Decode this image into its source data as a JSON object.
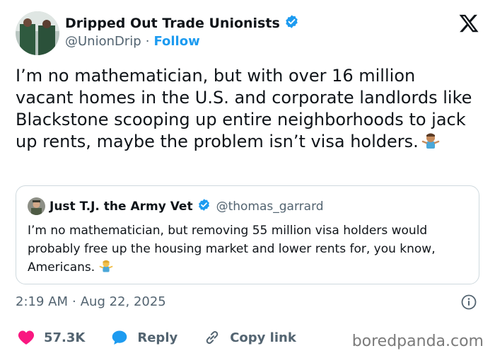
{
  "author": {
    "display_name": "Dripped Out Trade Unionists",
    "handle": "@UnionDrip",
    "separator": "·",
    "follow_label": "Follow",
    "verified": true
  },
  "tweet": {
    "text": "I’m no mathematician, but with over 16 million vacant homes in the U.S. and corporate landlords like Blackstone scooping up entire neighborhoods to jack up rents, maybe the problem isn’t visa holders.",
    "emoji": "shrug"
  },
  "quoted_tweet": {
    "display_name": "Just T.J. the Army Vet",
    "handle": "@thomas_garrard",
    "verified": true,
    "text": "I’m no mathematician, but removing 55 million visa holders would probably free up the housing market and lower rents for, you know, Americans.",
    "emoji": "shrug"
  },
  "meta": {
    "time": "2:19 AM",
    "separator": "·",
    "date": "Aug 22, 2025"
  },
  "actions": {
    "likes": "57.3K",
    "reply_label": "Reply",
    "copy_link_label": "Copy link"
  },
  "watermark": "boredpanda.com",
  "colors": {
    "accent": "#1d9bf0",
    "like": "#f91880",
    "text": "#0f1419",
    "muted": "#536471",
    "border": "#cfd9de"
  }
}
